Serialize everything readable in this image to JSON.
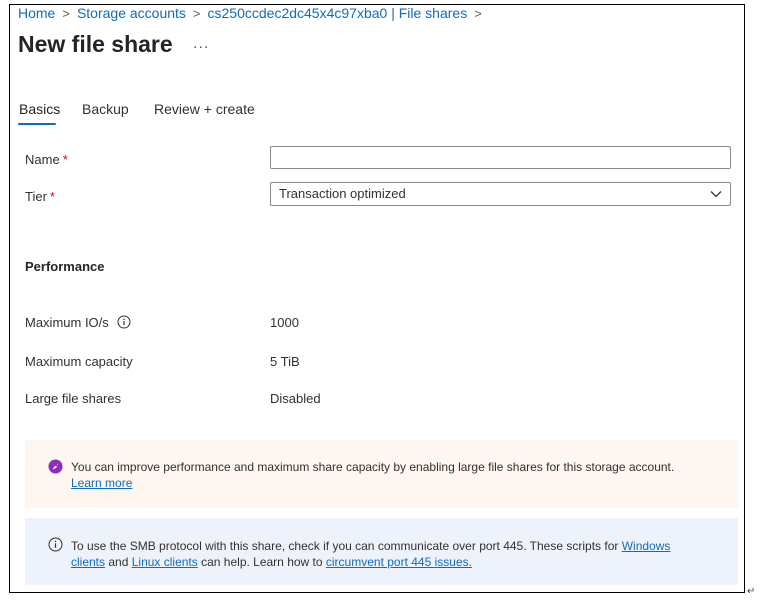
{
  "breadcrumb": {
    "items": [
      "Home",
      "Storage accounts",
      "cs250ccdec2dc45x4c97xba0 | File shares"
    ],
    "separator": ">"
  },
  "page": {
    "title": "New file share",
    "more": "..."
  },
  "tabs": [
    {
      "label": "Basics",
      "active": true
    },
    {
      "label": "Backup",
      "active": false
    },
    {
      "label": "Review + create",
      "active": false
    }
  ],
  "form": {
    "name": {
      "label": "Name",
      "required_mark": "*",
      "value": ""
    },
    "tier": {
      "label": "Tier",
      "required_mark": "*",
      "value": "Transaction optimized"
    }
  },
  "performance": {
    "title": "Performance",
    "rows": [
      {
        "label": "Maximum IO/s",
        "value": "1000"
      },
      {
        "label": "Maximum capacity",
        "value": "5 TiB"
      },
      {
        "label": "Large file shares",
        "value": "Disabled"
      }
    ]
  },
  "warning_banner": {
    "text": "You can improve performance and maximum share capacity by enabling large file shares for this storage account.",
    "link": "Learn more"
  },
  "info_banner": {
    "text_before": "To use the SMB protocol with this share, check if you can communicate over port 445. These scripts for",
    "link_windows": "Windows clients",
    "text_and": "and",
    "link_linux": "Linux clients",
    "text_middle": "can help. Learn how to",
    "link_port": "circumvent port 445 issues."
  },
  "colors": {
    "link": "#0f6cbd",
    "required": "#c50f1f",
    "warning_bg": "#fdf6f1",
    "warning_icon": "#8b2fb6",
    "info_bg": "#eef3fb"
  },
  "icons": {
    "info": "info-icon",
    "rocket": "rocket-icon",
    "dropdown": "chevron-down-icon"
  },
  "return_mark": "↵"
}
